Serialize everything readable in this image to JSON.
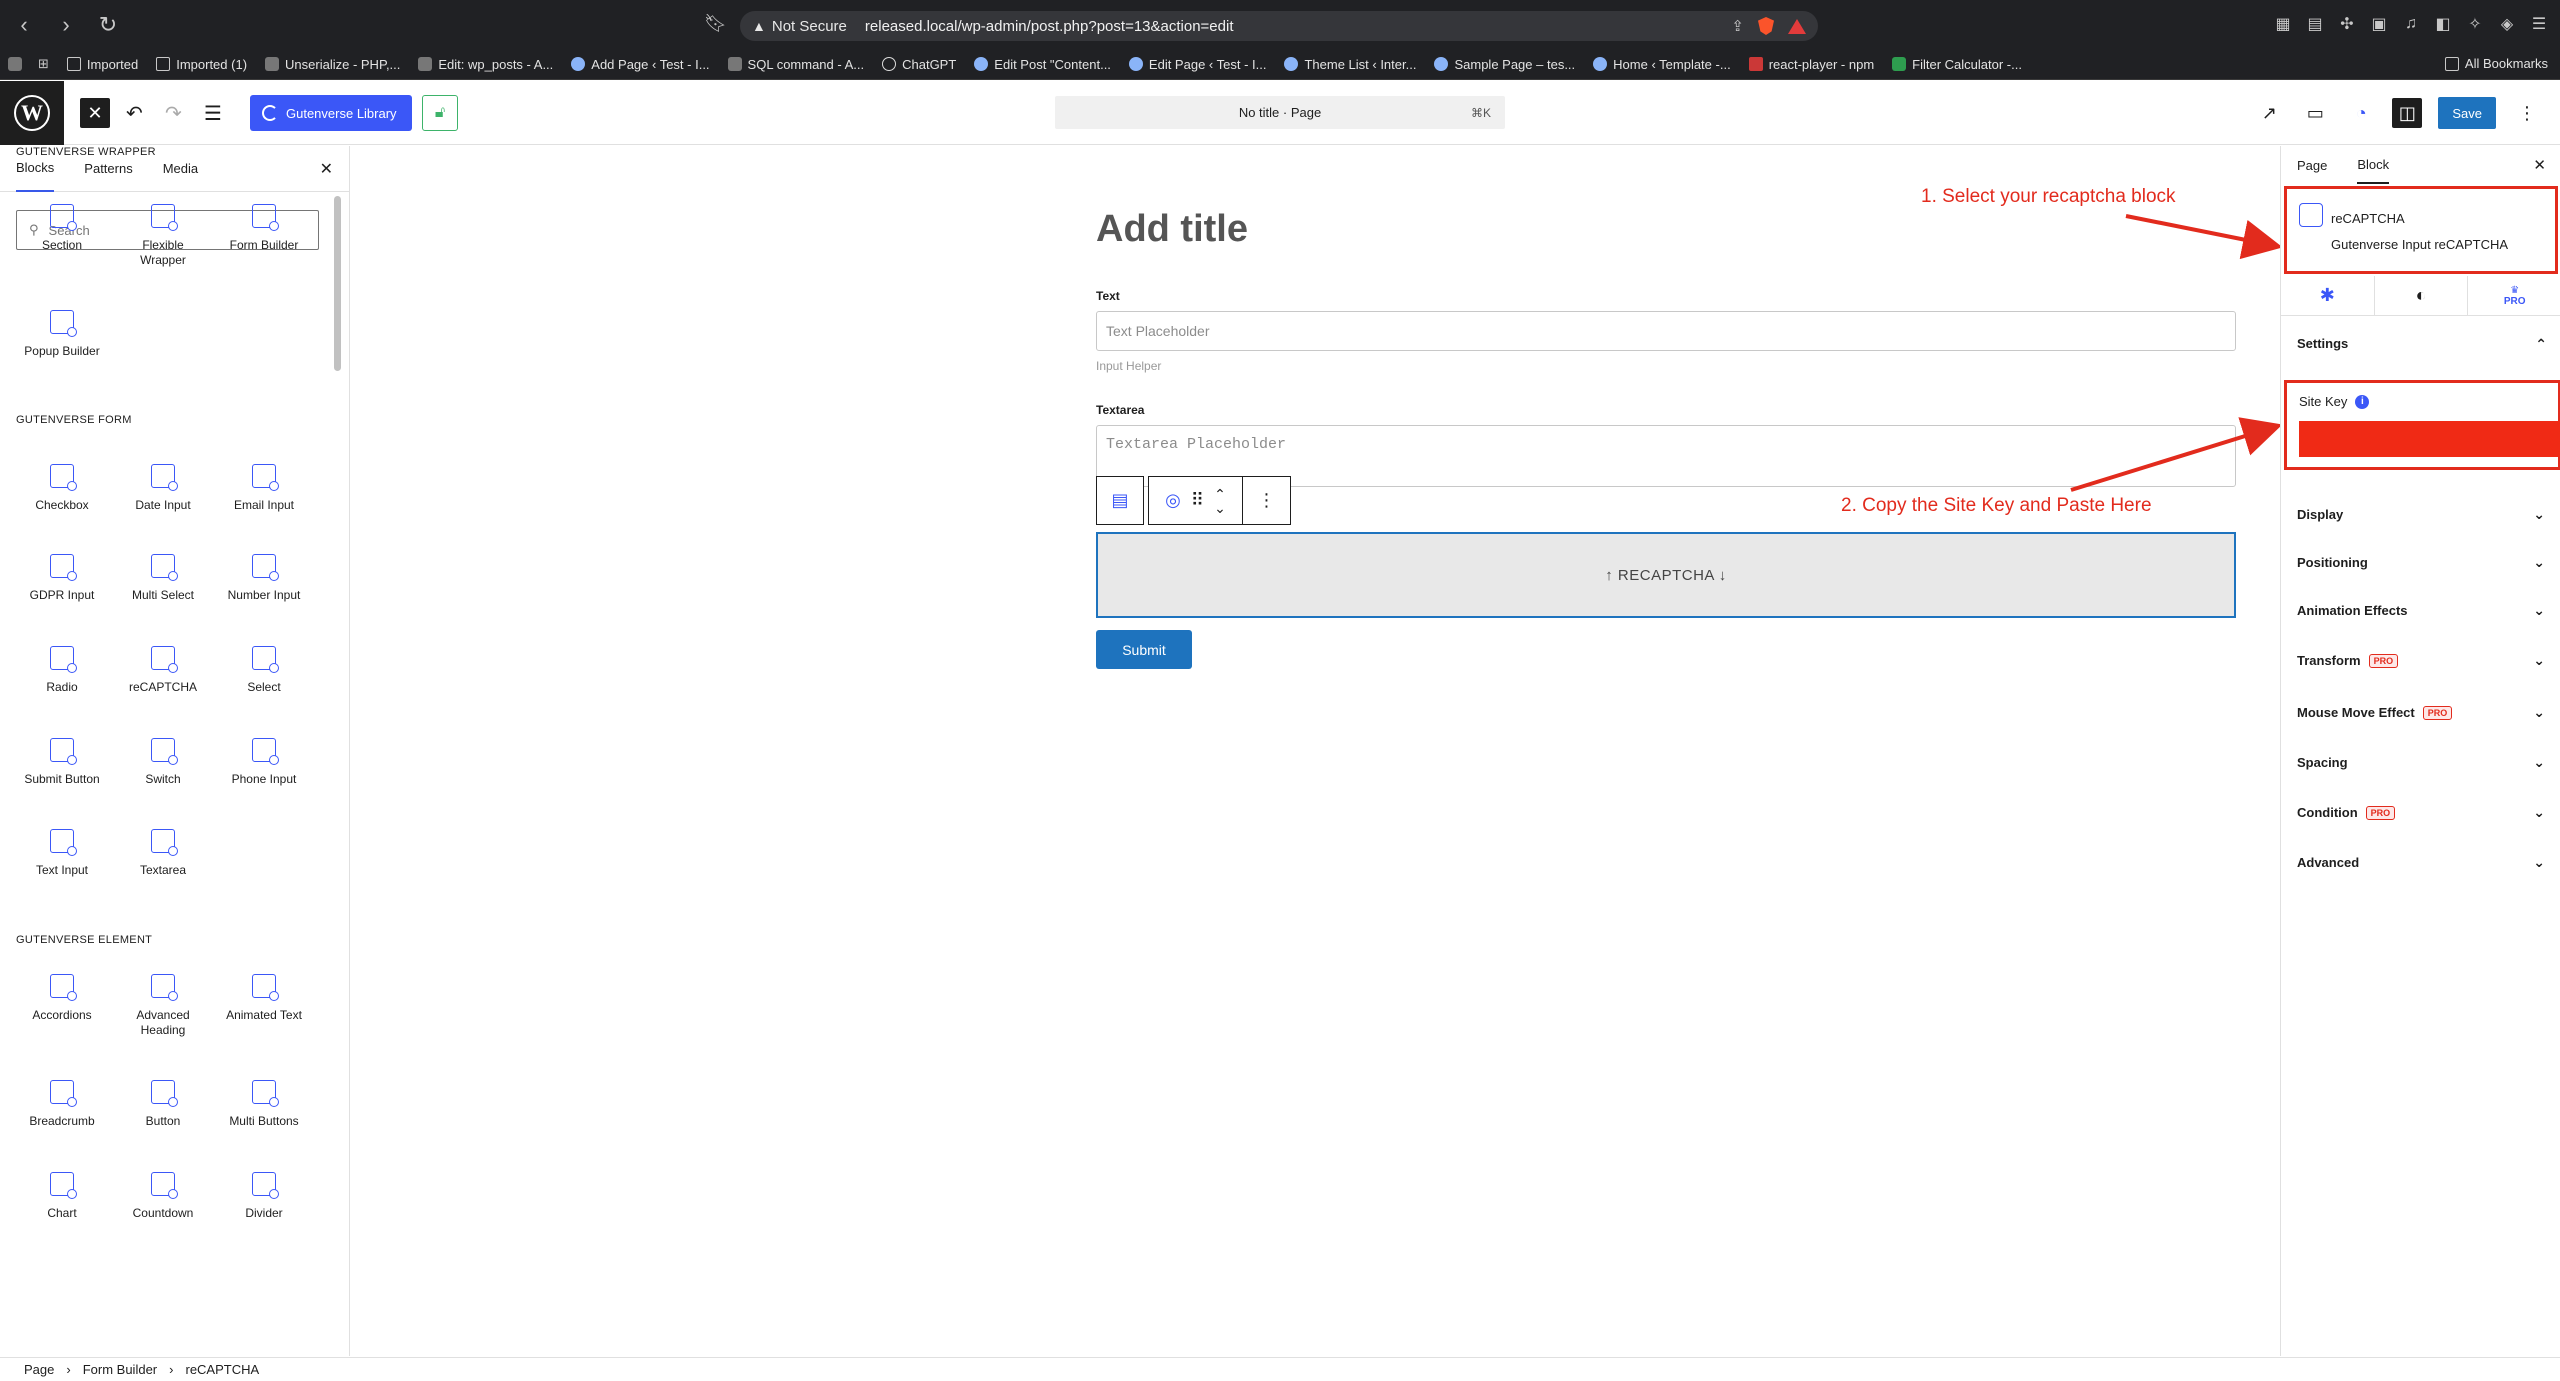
{
  "browser": {
    "security": "Not Secure",
    "url": "released.local/wp-admin/post.php?post=13&action=edit",
    "bookmarks": [
      {
        "label": "Imported",
        "icon": "folder"
      },
      {
        "label": "Imported (1)",
        "icon": "folder"
      },
      {
        "label": "Unserialize - PHP,...",
        "icon": "gray"
      },
      {
        "label": "Edit: wp_posts - A...",
        "icon": "gray"
      },
      {
        "label": "Add Page ‹ Test - I...",
        "icon": "wp"
      },
      {
        "label": "SQL command - A...",
        "icon": "gray"
      },
      {
        "label": "ChatGPT",
        "icon": "gpt"
      },
      {
        "label": "Edit Post \"Content...",
        "icon": "wp"
      },
      {
        "label": "Edit Page ‹ Test - I...",
        "icon": "wp"
      },
      {
        "label": "Theme List ‹ Inter...",
        "icon": "wp"
      },
      {
        "label": "Sample Page – tes...",
        "icon": "wp"
      },
      {
        "label": "Home ‹ Template -...",
        "icon": "wp"
      },
      {
        "label": "react-player - npm",
        "icon": "npm"
      },
      {
        "label": "Filter Calculator -...",
        "icon": "green"
      }
    ],
    "all_bookmarks": "All Bookmarks"
  },
  "header": {
    "gutenverse_library": "Gutenverse Library",
    "doc_title": "No title · Page",
    "shortcut": "⌘K",
    "save": "Save"
  },
  "inserter": {
    "tabs": [
      "Blocks",
      "Patterns",
      "Media"
    ],
    "search_placeholder": "Search",
    "categories": [
      {
        "title": "GUTENVERSE WRAPPER",
        "blocks": [
          "Section",
          "Flexible Wrapper",
          "Form Builder",
          "Popup Builder"
        ]
      },
      {
        "title": "GUTENVERSE FORM",
        "blocks": [
          "Checkbox",
          "Date Input",
          "Email Input",
          "GDPR Input",
          "Multi Select",
          "Number Input",
          "Radio",
          "reCAPTCHA",
          "Select",
          "Submit Button",
          "Switch",
          "Phone Input",
          "Text Input",
          "Textarea"
        ]
      },
      {
        "title": "GUTENVERSE ELEMENT",
        "blocks": [
          "Accordions",
          "Advanced Heading",
          "Animated Text",
          "Breadcrumb",
          "Button",
          "Multi Buttons",
          "Chart",
          "Countdown",
          "Divider"
        ]
      }
    ]
  },
  "canvas": {
    "title_placeholder": "Add title",
    "text_label": "Text",
    "text_placeholder": "Text Placeholder",
    "input_helper": "Input Helper",
    "textarea_label": "Textarea",
    "textarea_placeholder": "Textarea Placeholder",
    "recaptcha_label": "↑ RECAPTCHA ↓",
    "submit": "Submit"
  },
  "annotations": {
    "step1": "1. Select your recaptcha block",
    "step2": "2. Copy the Site Key and Paste Here",
    "color": "#e22b1d"
  },
  "settings_panel": {
    "tabs": [
      "Page",
      "Block"
    ],
    "block_name": "reCAPTCHA",
    "block_desc": "Gutenverse Input reCAPTCHA",
    "pro_label": "PRO",
    "settings": "Settings",
    "site_key": "Site Key",
    "sections": [
      {
        "label": "Display",
        "pro": false
      },
      {
        "label": "Positioning",
        "pro": false
      },
      {
        "label": "Animation Effects",
        "pro": false
      },
      {
        "label": "Transform",
        "pro": true
      },
      {
        "label": "Mouse Move Effect",
        "pro": true
      },
      {
        "label": "Spacing",
        "pro": false
      },
      {
        "label": "Condition",
        "pro": true
      },
      {
        "label": "Advanced",
        "pro": false
      }
    ]
  },
  "breadcrumb": [
    "Page",
    "Form Builder",
    "reCAPTCHA"
  ],
  "colors": {
    "accent": "#3b57f7",
    "wp_blue": "#1e73be",
    "highlight_red": "#e22b1d"
  }
}
